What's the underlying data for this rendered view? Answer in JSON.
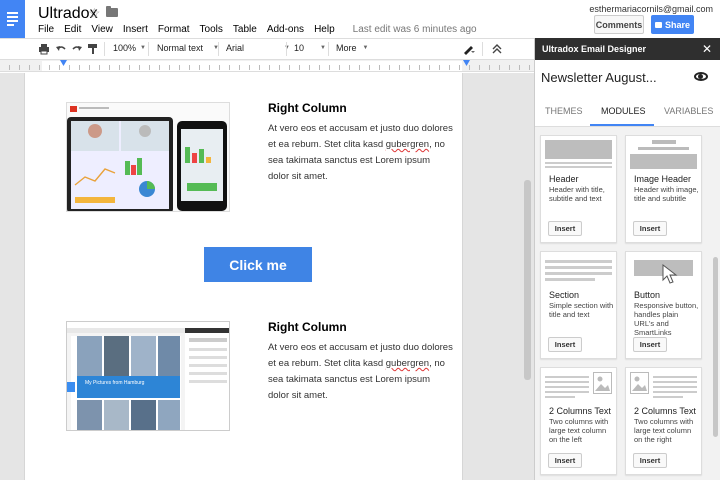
{
  "app": {
    "title": "Ultradox",
    "last_edit": "Last edit was 6 minutes ago",
    "user_email": "esthermariacornils@gmail.com"
  },
  "menu": [
    "File",
    "Edit",
    "View",
    "Insert",
    "Format",
    "Tools",
    "Table",
    "Add-ons",
    "Help"
  ],
  "header_buttons": {
    "comments": "Comments",
    "share": "Share"
  },
  "toolbar": {
    "zoom": "100%",
    "style": "Normal text",
    "font": "Arial",
    "size": "10",
    "more": "More"
  },
  "document": {
    "sections": [
      {
        "heading": "Right Column",
        "body_before": "At vero eos et accusam et justo duo dolores et ea rebum. Stet clita kasd ",
        "misspelled": "gubergren",
        "body_after": ", no sea takimata sanctus est Lorem ipsum dolor sit amet."
      },
      {
        "heading": "Right Column",
        "body_before": "At vero eos et accusam et justo duo dolores et ea rebum. Stet clita kasd ",
        "misspelled": "gubergren",
        "body_after": ", no sea takimata sanctus est Lorem ipsum dolor sit amet."
      }
    ],
    "button_label": "Click me",
    "image2_caption": "My Pictures from Hamburg"
  },
  "sidebar": {
    "header": "Ultradox Email Designer",
    "close": "✕",
    "title": "Newsletter August...",
    "tabs": [
      "THEMES",
      "MODULES",
      "VARIABLES"
    ],
    "active_tab": "MODULES",
    "insert_label": "Insert",
    "modules": [
      {
        "name": "Header",
        "desc": "Header with title, subtitle and text"
      },
      {
        "name": "Image Header",
        "desc": "Header with image, title and subtitle"
      },
      {
        "name": "Section",
        "desc": "Simple section with title and text"
      },
      {
        "name": "Button",
        "desc": "Responsive button, handles plain URL's and SmartLinks"
      },
      {
        "name": "2 Columns Text",
        "desc": "Two columns with large text column on the left"
      },
      {
        "name": "2 Columns Text",
        "desc": "Two columns with large text column on the right"
      }
    ]
  }
}
